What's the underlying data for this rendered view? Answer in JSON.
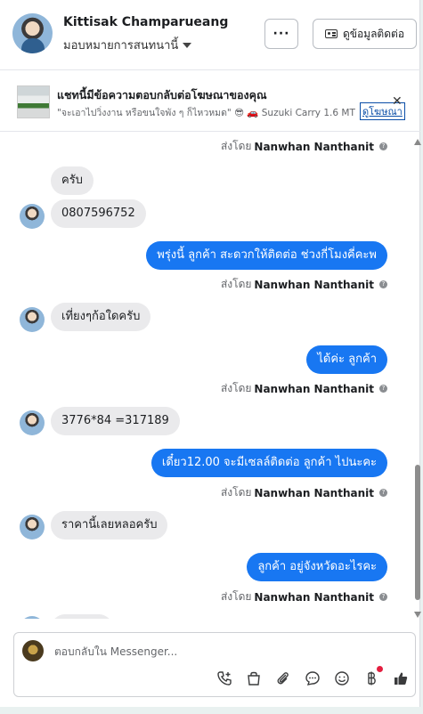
{
  "header": {
    "name": "Kittisak Champarueang",
    "assign_label": "มอบหมายการสนทนานี้",
    "more_label": "···",
    "contact_label": "ดูข้อมูลติดต่อ"
  },
  "banner": {
    "title": "แชทนี้มีข้อความตอบกลับต่อโฆษณาของคุณ",
    "subtitle": "\"จะเอาไปวิ่งงาน หรือขนใจพัง ๆ ก็ไหวหมด\" 😎 🚗 Suzuki Carry 1.6 MT ...",
    "link_label": "ดูโฆษณา",
    "close_label": "✕"
  },
  "messages": {
    "sent_prefix": "ส่งโดย",
    "sender": "Nanwhan Nanthanit",
    "info": "?",
    "m1": "ครับ",
    "m2": "0807596752",
    "m3": "พรุ่งนี้ ลูกค้า สะดวกให้ติดต่อ ช่วงกี่โมงคี่คะพ",
    "m4": "เที่ยงๆก้อใดครับ",
    "m5": "ได้ค่ะ  ลูกค้า",
    "m6": "3776*84  =317189",
    "m7": "เดี๋ยว12.00 จะมีเซลล์ติดต่อ ลูกค้า ไปนะคะ",
    "m8": "ราคานี้เลยหลอครับ",
    "m9": "ลูกค้า อยู่จังหวัดอะไรคะ"
  },
  "composer": {
    "placeholder": "ตอบกลับใน Messenger...",
    "tools": [
      "call-add-icon",
      "bag-icon",
      "attach-icon",
      "chat-bubble-icon",
      "emoji-icon",
      "baht-icon",
      "thumbs-up-icon"
    ]
  },
  "colors": {
    "accent": "#1877f2",
    "incoming": "#eaeaec",
    "badge": "#e41e3f"
  }
}
